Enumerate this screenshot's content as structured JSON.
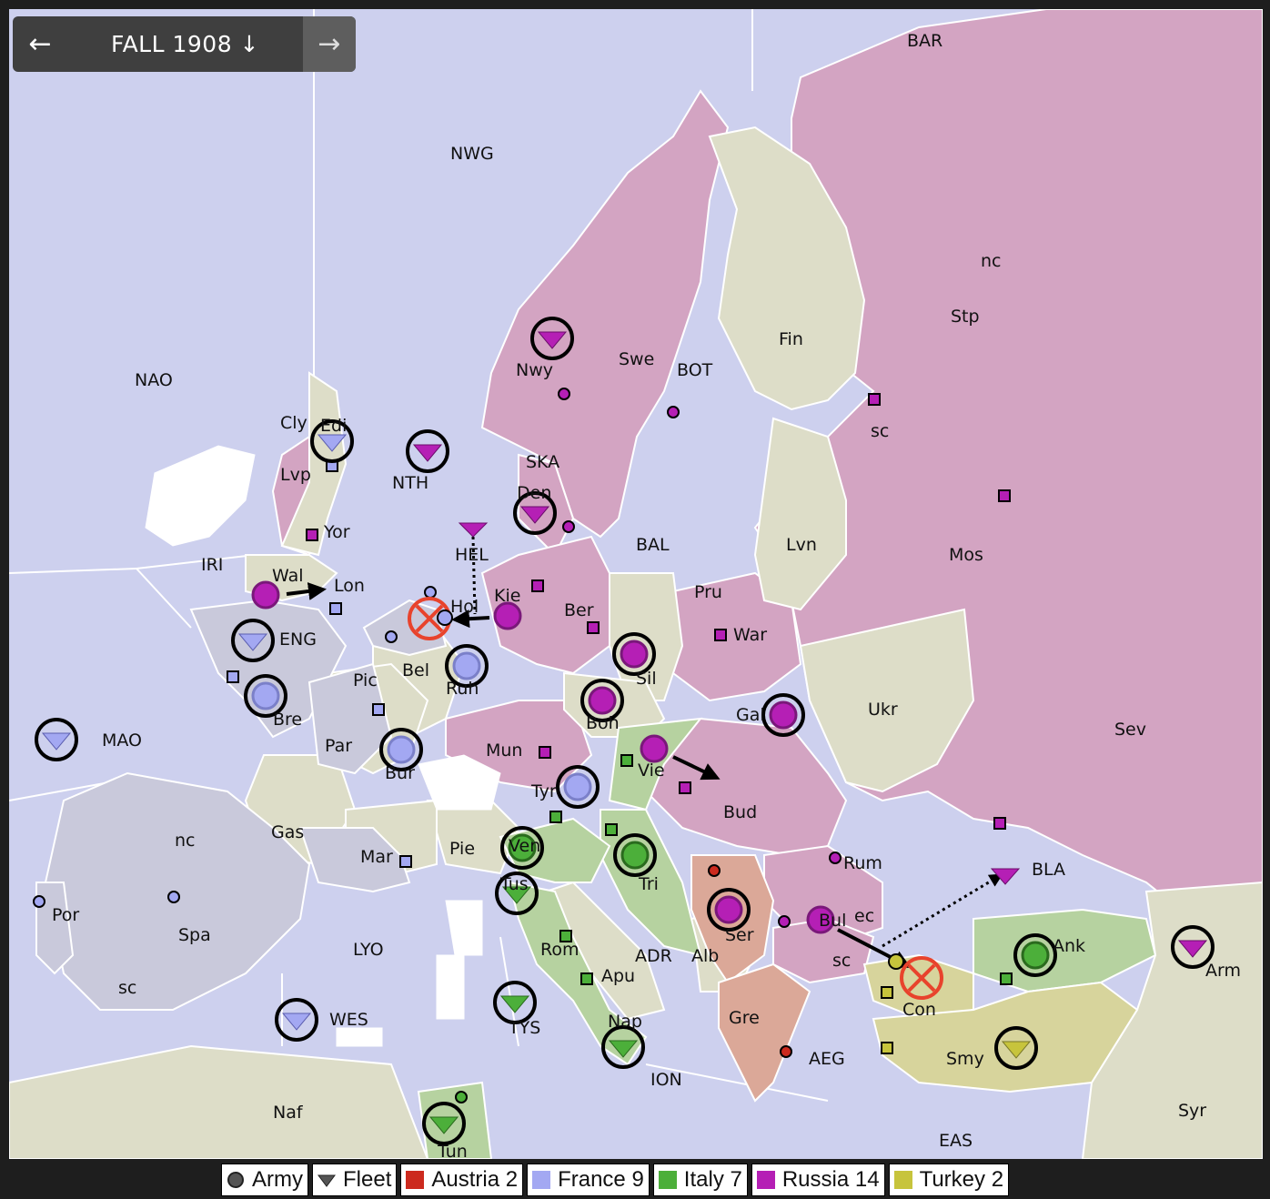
{
  "header": {
    "title": "FALL 1908 ↓",
    "prev_icon": "←",
    "next_icon": "→"
  },
  "legend": [
    {
      "label": "Army",
      "kind": "army",
      "color": "#555555"
    },
    {
      "label": "Fleet",
      "kind": "fleet",
      "color": "#555555"
    },
    {
      "label": "Austria 2",
      "kind": "power",
      "color": "#cc2a1e"
    },
    {
      "label": "France 9",
      "kind": "power",
      "color": "#a3a8f2"
    },
    {
      "label": "Italy 7",
      "kind": "power",
      "color": "#4caf3a"
    },
    {
      "label": "Russia 14",
      "kind": "power",
      "color": "#b51fb5"
    },
    {
      "label": "Turkey 2",
      "kind": "power",
      "color": "#c7c43c"
    }
  ],
  "colors": {
    "sea": "#cdd0ee",
    "neutral": "#ddddc8",
    "russia": "#d3a4c2",
    "france": "#c9c9db",
    "italy": "#b6d2a0",
    "austria": "#dba898",
    "turkey": "#d7d49c",
    "unit_russia": "#b51fb5",
    "unit_france": "#a3a8f2",
    "unit_italy": "#4caf3a",
    "unit_turkey": "#c7c43c",
    "dislodged": "#e8432c"
  },
  "labels": {
    "BAR": "BAR",
    "NWG": "NWG",
    "NAO": "NAO",
    "nc_stp": "nc",
    "Stp": "Stp",
    "Fin": "Fin",
    "Swe": "Swe",
    "BOT": "BOT",
    "Nwy": "Nwy",
    "sc_stp": "sc",
    "Cly": "Cly",
    "Edi": "Edi",
    "NTH": "NTH",
    "SKA": "SKA",
    "Lvp": "Lvp",
    "Den": "Den",
    "Yor": "Yor",
    "IRI": "IRI",
    "HEL": "HEL",
    "BAL": "BAL",
    "Lvn": "Lvn",
    "Mos": "Mos",
    "Wal": "Wal",
    "Lon": "Lon",
    "Kie": "Kie",
    "Hol": "Hol",
    "Ber": "Ber",
    "Pru": "Pru",
    "ENG": "ENG",
    "War": "War",
    "Bel": "Bel",
    "Pic": "Pic",
    "Ruh": "Ruh",
    "Sil": "Sil",
    "Ukr": "Ukr",
    "Bre": "Bre",
    "Gal": "Gal",
    "Bohm": "Boh",
    "MAO": "MAO",
    "Par": "Par",
    "Sev": "Sev",
    "Mun": "Mun",
    "Vie": "Vie",
    "Bur": "Bur",
    "Tyr": "Tyr",
    "Bud": "Bud",
    "Gas": "Gas",
    "nc_spa": "nc",
    "Ven": "Ven",
    "Pie": "Pie",
    "Mar": "Mar",
    "Rum": "Rum",
    "Tri": "Tri",
    "BLA": "BLA",
    "Tus": "Tus",
    "Por": "Por",
    "Spa": "Spa",
    "Ser": "Ser",
    "ec_bul": "ec",
    "Bul": "Bul",
    "Ank": "Ank",
    "Arm": "Arm",
    "LYO": "LYO",
    "Rom": "Rom",
    "ADR": "ADR",
    "Alb": "Alb",
    "sc_bul": "sc",
    "sc_spa": "sc",
    "Apu": "Apu",
    "Con": "Con",
    "WES": "WES",
    "TYS": "TYS",
    "Nap": "Nap",
    "Gre": "Gre",
    "AEG": "AEG",
    "Smy": "Smy",
    "ION": "ION",
    "Naf": "Naf",
    "Syr": "Syr",
    "EAS": "EAS",
    "Tun": "Tun"
  }
}
